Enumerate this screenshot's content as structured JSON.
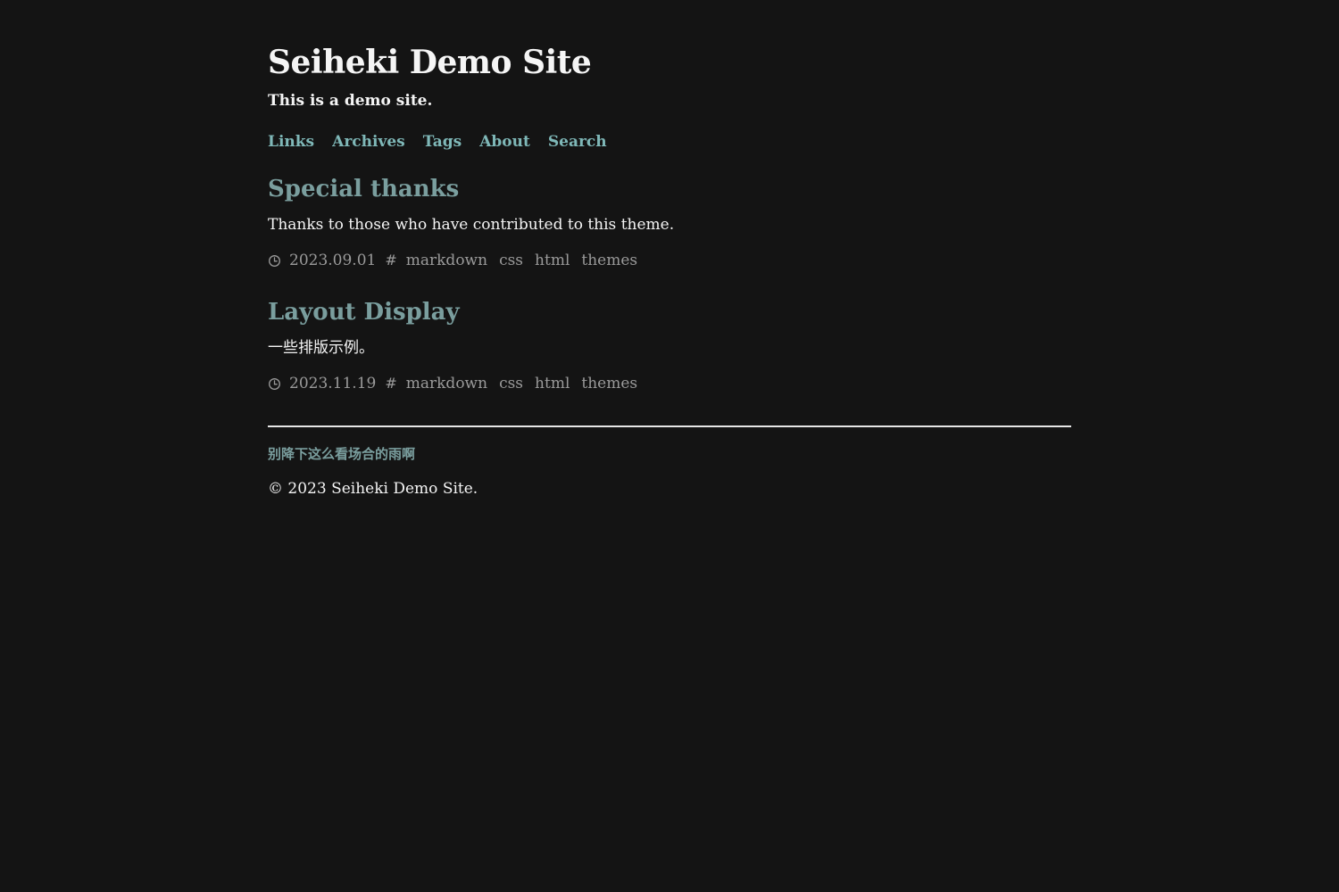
{
  "site": {
    "title": "Seiheki Demo Site",
    "description": "This is a demo site."
  },
  "nav": {
    "items": [
      "Links",
      "Archives",
      "Tags",
      "About",
      "Search"
    ]
  },
  "posts": [
    {
      "title": "Special thanks",
      "excerpt": "Thanks to those who have contributed to this theme.",
      "date": "2023.09.01",
      "tags": [
        "markdown",
        "css",
        "html",
        "themes"
      ]
    },
    {
      "title": "Layout Display",
      "excerpt": "一些排版示例。",
      "date": "2023.11.19",
      "tags": [
        "markdown",
        "css",
        "html",
        "themes"
      ]
    }
  ],
  "footer": {
    "quote": "别降下这么看场合的雨啊",
    "copyright": "© 2023 Seiheki Demo Site."
  },
  "icons": {
    "date": "clock-icon",
    "tags": "hash-icon"
  },
  "colors": {
    "background": "#141414",
    "text": "#f5f5f5",
    "nav_link": "#7fb8b8",
    "post_title": "#7a9e9e",
    "meta": "#9a9a9a",
    "divider": "#e6e6e6"
  }
}
